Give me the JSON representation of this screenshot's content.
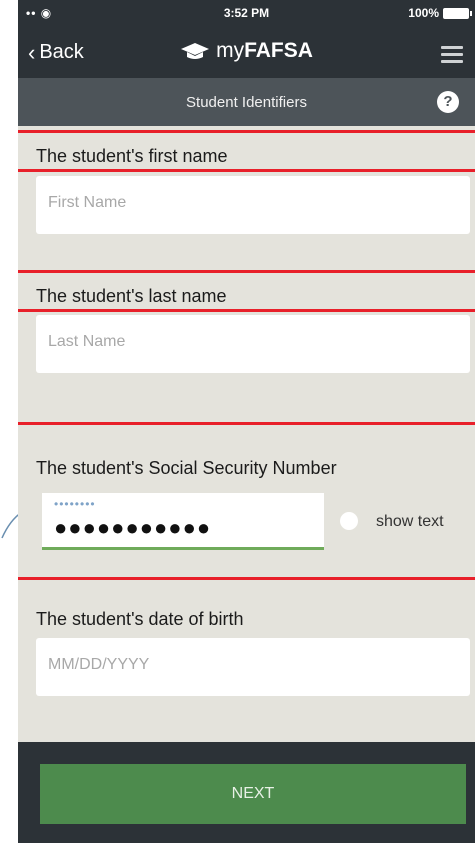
{
  "status": {
    "signal": "•• ◉",
    "time": "3:52 PM",
    "battery": "100%"
  },
  "nav": {
    "back_label": "Back",
    "brand_prefix": "my",
    "brand_bold": "FAFSA",
    "back_icon": "chevron-left-icon",
    "brand_icon": "graduation-cap-icon",
    "menu_icon": "hamburger-menu-icon"
  },
  "section": {
    "title": "Student Identifiers",
    "help_glyph": "?"
  },
  "fields": {
    "first_name": {
      "label": "The student's first name",
      "placeholder": "First Name"
    },
    "last_name": {
      "label": "The student's last name",
      "placeholder": "Last Name"
    },
    "ssn": {
      "label": "The student's Social Security Number",
      "hint": "••••••••",
      "value": "●●●●●●●●●●●",
      "show_text_label": "show text"
    },
    "dob": {
      "label": "The student's date of birth",
      "placeholder": "MM/DD/YYYY"
    }
  },
  "footer": {
    "next_label": "NEXT"
  },
  "colors": {
    "header": "#2c3237",
    "subheader": "#4d5459",
    "background": "#e4e3dc",
    "accent_green": "#4d8b4d",
    "highlight_red": "#e8202a"
  }
}
